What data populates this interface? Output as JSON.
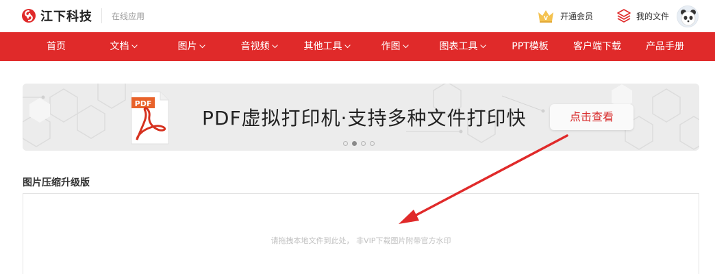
{
  "header": {
    "logo_text": "江下科技",
    "logo_sub": "在线应用",
    "vip_label": "开通会员",
    "myfiles_label": "我的文件",
    "icons": {
      "logo": "spiral-logo-icon",
      "vip": "crown-icon",
      "files": "layers-icon",
      "avatar": "panda-avatar"
    }
  },
  "nav": {
    "items": [
      {
        "label": "首页",
        "dropdown": false
      },
      {
        "label": "文档",
        "dropdown": true
      },
      {
        "label": "图片",
        "dropdown": true
      },
      {
        "label": "音视频",
        "dropdown": true
      },
      {
        "label": "其他工具",
        "dropdown": true
      },
      {
        "label": "作图",
        "dropdown": true
      },
      {
        "label": "图表工具",
        "dropdown": true
      },
      {
        "label": "PPT模板",
        "dropdown": false
      },
      {
        "label": "客户端下载",
        "dropdown": false
      },
      {
        "label": "产品手册",
        "dropdown": false
      }
    ]
  },
  "banner": {
    "pdf_badge": "PDF",
    "headline": "PDF虚拟打印机·支持多种文件打印快",
    "button_label": "点击查看",
    "slide_count": 4,
    "active_slide": 2
  },
  "section": {
    "title": "图片压缩升级版",
    "drop_hint": "请拖拽本地文件到此处， 非VIP下载图片附带官方水印"
  },
  "colors": {
    "brand_red": "#e02a2a",
    "button_text": "#d82d2d",
    "annotation_arrow": "#e02a2a"
  }
}
